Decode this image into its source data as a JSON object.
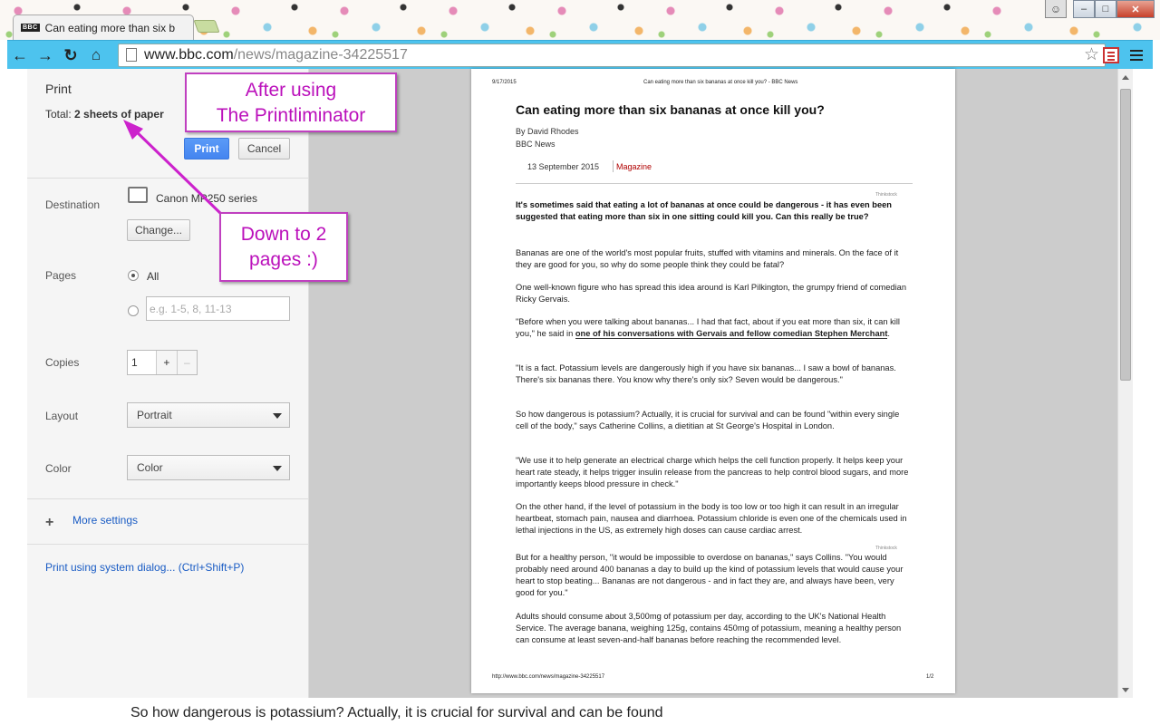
{
  "browser": {
    "tab_title": "Can eating more than six b",
    "favicon_text": "BBC",
    "url_host": "www.bbc.com",
    "url_path": "/news/magazine-34225517",
    "window_controls": {
      "minimize": "–",
      "maximize": "□",
      "close": "✕"
    }
  },
  "print_panel": {
    "title": "Print",
    "total_label": "Total:",
    "total_value": "2 sheets of paper",
    "print_button": "Print",
    "cancel_button": "Cancel",
    "destination_label": "Destination",
    "destination_name": "Canon MP250 series",
    "change_button": "Change...",
    "pages_label": "Pages",
    "pages_all": "All",
    "pages_placeholder": "e.g. 1-5, 8, 11-13",
    "copies_label": "Copies",
    "copies_value": "1",
    "copies_plus": "+",
    "copies_minus": "–",
    "layout_label": "Layout",
    "layout_value": "Portrait",
    "color_label": "Color",
    "color_value": "Color",
    "more_settings_icon": "+",
    "more_settings": "More settings",
    "system_dialog_link": "Print using system dialog... (Ctrl+Shift+P)"
  },
  "preview": {
    "header_date": "9/17/2015",
    "header_title": "Can eating more than six bananas at once kill you? - BBC News",
    "footer_url": "http://www.bbc.com/news/magazine-34225517",
    "footer_page": "1/2",
    "article_title": "Can eating more than six bananas at once kill you?",
    "byline": "By David Rhodes",
    "source": "BBC News",
    "date": "13 September 2015",
    "section": "Magazine",
    "credit": "Thinkstock",
    "paragraphs": [
      "It's sometimes said that eating a lot of bananas at once could be dangerous - it has even been suggested that eating more than six in one sitting could kill you. Can this really be true?",
      "Bananas are one of the world's most popular fruits, stuffed with vitamins and minerals. On the face of it they are good for you, so why do some people think they could be fatal?",
      "One well-known figure who has spread this idea around is Karl Pilkington, the grumpy friend of comedian Ricky Gervais.",
      "\"Before when you were talking about bananas... I had that fact, about if you eat more than six, it can kill you,\" he said in ",
      "one of his conversations with Gervais and fellow comedian Stephen Merchant",
      ".",
      "\"It is a fact. Potassium levels are dangerously high if you have six bananas... I saw a bowl of bananas. There's six bananas there. You know why there's only six? Seven would be dangerous.\"",
      "So how dangerous is potassium? Actually, it is crucial for survival and can be found \"within every single cell of the body,\" says Catherine Collins, a dietitian at St George's Hospital in London.",
      "\"We use it to help generate an electrical charge which helps the cell function properly. It helps keep your heart rate steady, it helps trigger insulin release from the pancreas to help control blood sugars, and more importantly keeps blood pressure in check.\"",
      "On the other hand, if the level of potassium in the body is too low or too high it can result in an irregular heartbeat, stomach pain, nausea and diarrhoea. Potassium chloride is even one of the chemicals used in lethal injections in the US, as extremely high doses can cause cardiac arrest.",
      "But for a healthy person, \"it would be impossible to overdose on bananas,\" says Collins. \"You would probably need around 400 bananas a day to build up the kind of potassium levels that would cause your heart to stop beating... Bananas are not dangerous - and in fact they are, and always have been, very good for you.\"",
      "Adults should consume about 3,500mg of potassium per day, according to the UK's National Health Service. The average banana, weighing 125g, contains 450mg of potassium, meaning a healthy person can consume at least seven-and-half bananas before reaching the recommended level."
    ]
  },
  "background_page_text": "So how dangerous is potassium? Actually, it is crucial for survival and can be found",
  "annotations": {
    "callout_1_line1": "After using",
    "callout_1_line2": "The Printliminator",
    "callout_2_line1": "Down to 2",
    "callout_2_line2": "pages :)",
    "color": "#cc22cc"
  },
  "colors": {
    "toolbar": "#4dc3ee",
    "print_button": "#4485f0",
    "link": "#1a5cc4",
    "section": "#b00000"
  }
}
